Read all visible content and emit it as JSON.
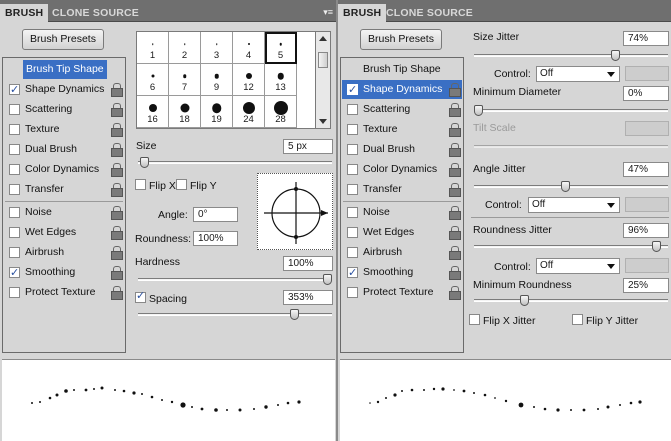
{
  "left": {
    "tabs": [
      "BRUSH",
      "CLONE SOURCE"
    ],
    "brush_presets": "Brush Presets",
    "items": [
      {
        "label": "Brush Tip Shape",
        "checked": false,
        "lock": false,
        "state": "selected"
      },
      {
        "label": "Shape Dynamics",
        "checked": true,
        "lock": true,
        "state": ""
      },
      {
        "label": "Scattering",
        "checked": false,
        "lock": true,
        "state": ""
      },
      {
        "label": "Texture",
        "checked": false,
        "lock": true,
        "state": ""
      },
      {
        "label": "Dual Brush",
        "checked": false,
        "lock": true,
        "state": ""
      },
      {
        "label": "Color Dynamics",
        "checked": false,
        "lock": true,
        "state": ""
      },
      {
        "label": "Transfer",
        "checked": false,
        "lock": true,
        "state": ""
      },
      {
        "label": "Noise",
        "checked": false,
        "lock": true,
        "state": ""
      },
      {
        "label": "Wet Edges",
        "checked": false,
        "lock": true,
        "state": ""
      },
      {
        "label": "Airbrush",
        "checked": false,
        "lock": true,
        "state": ""
      },
      {
        "label": "Smoothing",
        "checked": true,
        "lock": true,
        "state": ""
      },
      {
        "label": "Protect Texture",
        "checked": false,
        "lock": true,
        "state": ""
      }
    ],
    "brush_sizes": [
      "1",
      "2",
      "3",
      "4",
      "5",
      "6",
      "7",
      "9",
      "12",
      "13",
      "16",
      "18",
      "19",
      "24",
      "28"
    ],
    "size_label": "Size",
    "size_value": "5 px",
    "size_level": 0.01,
    "flip_x": "Flip X",
    "flip_y": "Flip Y",
    "angle_label": "Angle:",
    "angle_value": "0°",
    "roundness_label": "Roundness:",
    "roundness_value": "100%",
    "hardness_label": "Hardness",
    "hardness_value": "100%",
    "hardness_level": 1.0,
    "spacing_label": "Spacing",
    "spacing_value": "353%",
    "spacing_level": 0.82
  },
  "right": {
    "tabs": [
      "BRUSH",
      "CLONE SOURCE"
    ],
    "brush_presets": "Brush Presets",
    "items": [
      {
        "label": "Brush Tip Shape",
        "checked": false,
        "lock": false,
        "state": ""
      },
      {
        "label": "Shape Dynamics",
        "checked": true,
        "lock": true,
        "state": "highlighted"
      },
      {
        "label": "Scattering",
        "checked": false,
        "lock": true,
        "state": ""
      },
      {
        "label": "Texture",
        "checked": false,
        "lock": true,
        "state": ""
      },
      {
        "label": "Dual Brush",
        "checked": false,
        "lock": true,
        "state": ""
      },
      {
        "label": "Color Dynamics",
        "checked": false,
        "lock": true,
        "state": ""
      },
      {
        "label": "Transfer",
        "checked": false,
        "lock": true,
        "state": ""
      },
      {
        "label": "Noise",
        "checked": false,
        "lock": true,
        "state": ""
      },
      {
        "label": "Wet Edges",
        "checked": false,
        "lock": true,
        "state": ""
      },
      {
        "label": "Airbrush",
        "checked": false,
        "lock": true,
        "state": ""
      },
      {
        "label": "Smoothing",
        "checked": true,
        "lock": true,
        "state": ""
      },
      {
        "label": "Protect Texture",
        "checked": false,
        "lock": true,
        "state": ""
      }
    ],
    "size_jitter_label": "Size Jitter",
    "size_jitter_value": "74%",
    "size_jitter_level": 0.74,
    "control_label": "Control:",
    "control_label_indented": "Control:",
    "control_value": "Off",
    "min_diameter_label": "Minimum Diameter",
    "min_diameter_value": "0%",
    "min_diameter_level": 0.0,
    "tilt_scale_label": "Tilt Scale",
    "angle_jitter_label": "Angle Jitter",
    "angle_jitter_value": "47%",
    "angle_jitter_level": 0.47,
    "roundness_jitter_label": "Roundness Jitter",
    "roundness_jitter_value": "96%",
    "roundness_jitter_level": 0.96,
    "min_roundness_label": "Minimum Roundness",
    "min_roundness_value": "25%",
    "min_roundness_level": 0.25,
    "flip_x_jitter": "Flip X Jitter",
    "flip_y_jitter": "Flip Y Jitter"
  },
  "colors": {
    "selection": "#3a6fc4",
    "tabbar": "#6f6f6f",
    "panel": "#d6d6d6"
  }
}
